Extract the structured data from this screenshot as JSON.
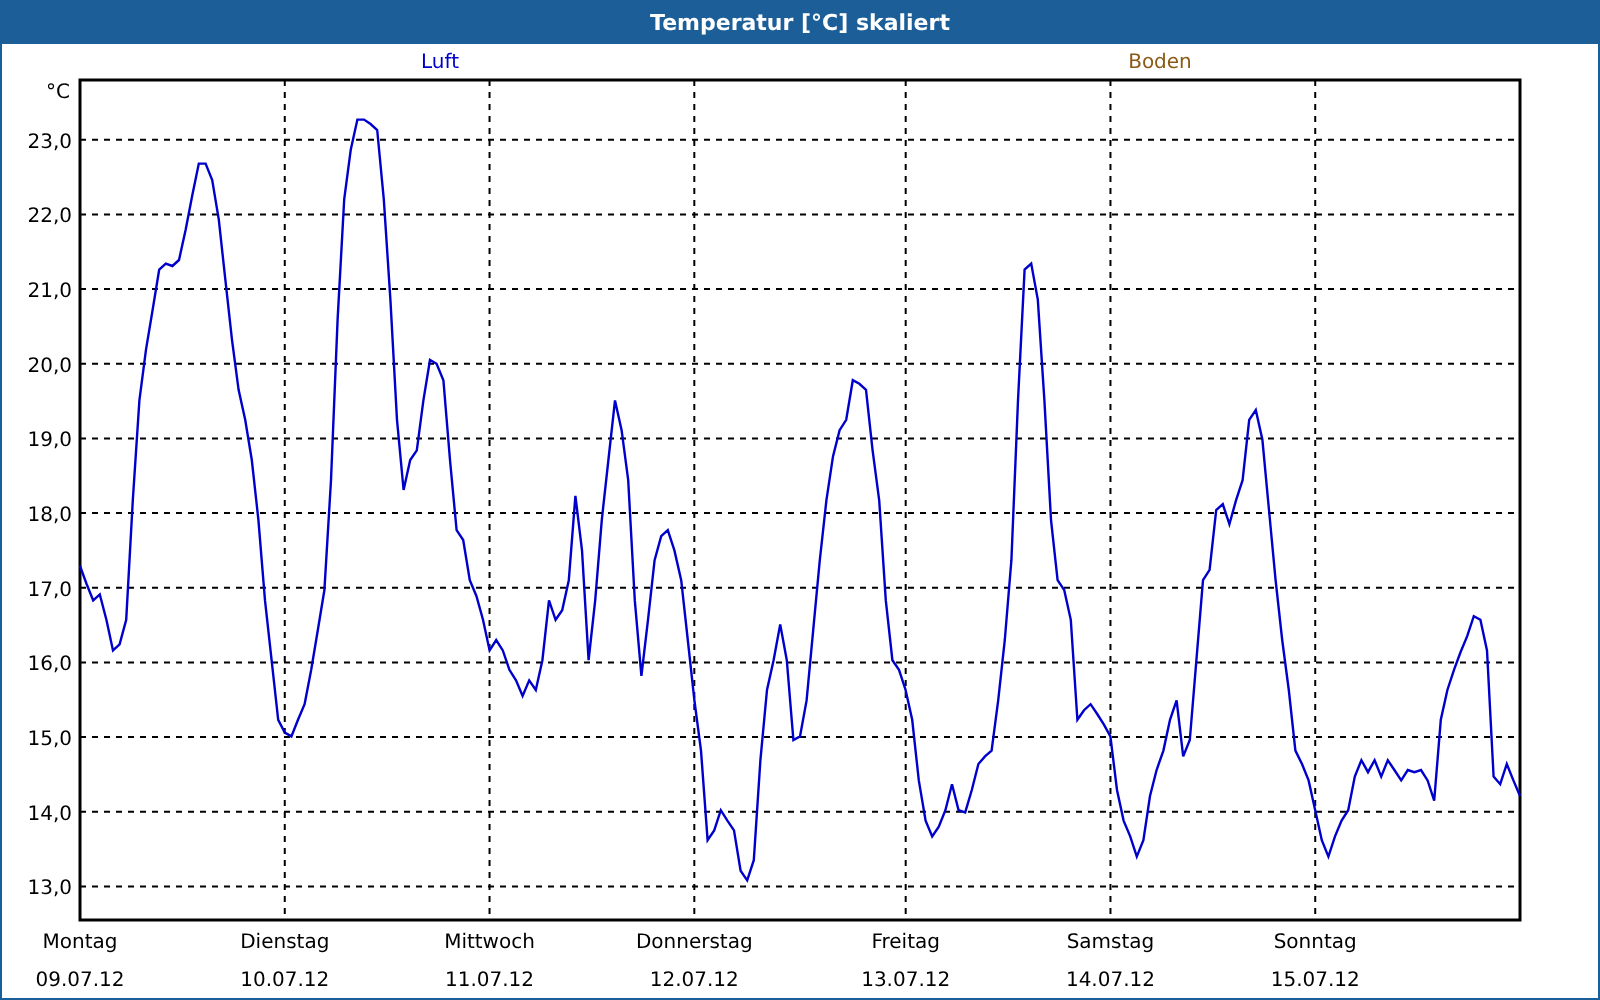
{
  "window": {
    "title": "Temperatur [°C] skaliert"
  },
  "chart": {
    "legend": [
      {
        "label": "Boden",
        "color": "#8b5a14"
      }
    ],
    "date_labels": [
      "09.07.12",
      "10.07.12",
      "11.07.12",
      "12.07.12",
      "13.07.12",
      "14.07.12",
      "15.07.12"
    ],
    "chart_data": {
      "type": "line",
      "grid": true,
      "ylabel": "°C",
      "ylim": [
        12.55,
        23.8
      ],
      "yticks": [
        {
          "value": 13,
          "label": "13,0"
        },
        {
          "value": 14,
          "label": "14,0"
        },
        {
          "value": 15,
          "label": "15,0"
        },
        {
          "value": 16,
          "label": "16,0"
        },
        {
          "value": 17,
          "label": "17,0"
        },
        {
          "value": 18,
          "label": "18,0"
        },
        {
          "value": 19,
          "label": "19,0"
        },
        {
          "value": 20,
          "label": "20,0"
        },
        {
          "value": 21,
          "label": "21,0"
        },
        {
          "value": 22,
          "label": "22,0"
        },
        {
          "value": 23,
          "label": "23,0"
        }
      ],
      "categories": [
        "Montag",
        null,
        null,
        null,
        null,
        null,
        null,
        null,
        null,
        null,
        null,
        null,
        null,
        null,
        null,
        null,
        null,
        null,
        null,
        null,
        null,
        null,
        null,
        null,
        null,
        null,
        null,
        null,
        null,
        null,
        null,
        "Dienstag",
        null,
        null,
        null,
        null,
        null,
        null,
        null,
        null,
        null,
        null,
        null,
        null,
        null,
        null,
        null,
        null,
        null,
        null,
        null,
        null,
        null,
        null,
        null,
        null,
        null,
        null,
        null,
        null,
        null,
        null,
        "Mittwoch",
        null,
        null,
        null,
        null,
        null,
        null,
        null,
        null,
        null,
        null,
        null,
        null,
        null,
        null,
        null,
        null,
        null,
        null,
        null,
        null,
        null,
        null,
        null,
        null,
        null,
        null,
        null,
        null,
        null,
        null,
        "Donnerstag",
        null,
        null,
        null,
        null,
        null,
        null,
        null,
        null,
        null,
        null,
        null,
        null,
        null,
        null,
        null,
        null,
        null,
        null,
        null,
        null,
        null,
        null,
        null,
        null,
        null,
        null,
        null,
        null,
        null,
        null,
        null,
        "Freitag",
        null,
        null,
        null,
        null,
        null,
        null,
        null,
        null,
        null,
        null,
        null,
        null,
        null,
        null,
        null,
        null,
        null,
        null,
        null,
        null,
        null,
        null,
        null,
        null,
        null,
        null,
        null,
        null,
        null,
        null,
        "Samstag",
        null,
        null,
        null,
        null,
        null,
        null,
        null,
        null,
        null,
        null,
        null,
        null,
        null,
        null,
        null,
        null,
        null,
        null,
        null,
        null,
        null,
        null,
        null,
        null,
        null,
        null,
        null,
        null,
        null,
        null,
        "Sonntag",
        null,
        null,
        null,
        null,
        null,
        null,
        null,
        null,
        null,
        null,
        null,
        null,
        null,
        null,
        null,
        null,
        null,
        null,
        null,
        null,
        null,
        null,
        null,
        null,
        null,
        null,
        null,
        null,
        null,
        null,
        null
      ],
      "series": [
        {
          "name": "Luft",
          "color": "#0000cc",
          "values": [
            17.29,
            17.05,
            16.83,
            16.91,
            16.57,
            16.16,
            16.24,
            16.57,
            18.17,
            19.51,
            20.19,
            20.72,
            21.26,
            21.34,
            21.31,
            21.39,
            21.79,
            22.25,
            22.68,
            22.68,
            22.46,
            21.93,
            21.12,
            20.32,
            19.65,
            19.25,
            18.71,
            17.91,
            16.83,
            16.03,
            15.23,
            15.06,
            15.01,
            15.23,
            15.44,
            15.9,
            16.43,
            16.97,
            18.44,
            20.59,
            22.2,
            22.87,
            23.27,
            23.27,
            23.21,
            23.13,
            22.2,
            20.86,
            19.25,
            18.31,
            18.71,
            18.84,
            19.51,
            20.05,
            20.0,
            19.78,
            18.71,
            17.77,
            17.64,
            17.1,
            16.89,
            16.57,
            16.16,
            16.3,
            16.16,
            15.9,
            15.76,
            15.55,
            15.76,
            15.63,
            16.03,
            16.83,
            16.57,
            16.7,
            17.1,
            18.23,
            17.5,
            16.03,
            16.83,
            17.91,
            18.71,
            19.51,
            19.11,
            18.44,
            16.83,
            15.82,
            16.57,
            17.37,
            17.69,
            17.77,
            17.5,
            17.1,
            16.3,
            15.49,
            14.82,
            13.62,
            13.75,
            14.02,
            13.88,
            13.75,
            13.21,
            13.08,
            13.35,
            14.69,
            15.63,
            16.03,
            16.51,
            16.03,
            14.96,
            15.01,
            15.49,
            16.43,
            17.37,
            18.17,
            18.76,
            19.11,
            19.25,
            19.78,
            19.73,
            19.65,
            18.84,
            18.17,
            16.83,
            16.03,
            15.9,
            15.63,
            15.23,
            14.42,
            13.88,
            13.67,
            13.8,
            14.02,
            14.37,
            14.02,
            13.99,
            14.29,
            14.64,
            14.74,
            14.82,
            15.49,
            16.3,
            17.37,
            19.51,
            21.26,
            21.34,
            20.86,
            19.51,
            17.91,
            17.1,
            16.97,
            16.57,
            15.23,
            15.36,
            15.44,
            15.31,
            15.17,
            15.01,
            14.29,
            13.88,
            13.67,
            13.4,
            13.62,
            14.21,
            14.56,
            14.82,
            15.23,
            15.49,
            14.74,
            14.96,
            16.03,
            17.1,
            17.24,
            18.04,
            18.12,
            17.85,
            18.17,
            18.44,
            19.25,
            19.38,
            18.98,
            18.04,
            17.1,
            16.3,
            15.63,
            14.82,
            14.64,
            14.42,
            14.02,
            13.62,
            13.4,
            13.67,
            13.88,
            14.02,
            14.47,
            14.69,
            14.53,
            14.69,
            14.47,
            14.69,
            14.56,
            14.42,
            14.56,
            14.53,
            14.56,
            14.42,
            14.15,
            15.23,
            15.63,
            15.9,
            16.14,
            16.35,
            16.62,
            16.57,
            16.16,
            14.47,
            14.37,
            14.64,
            14.42,
            14.21
          ]
        }
      ]
    }
  }
}
